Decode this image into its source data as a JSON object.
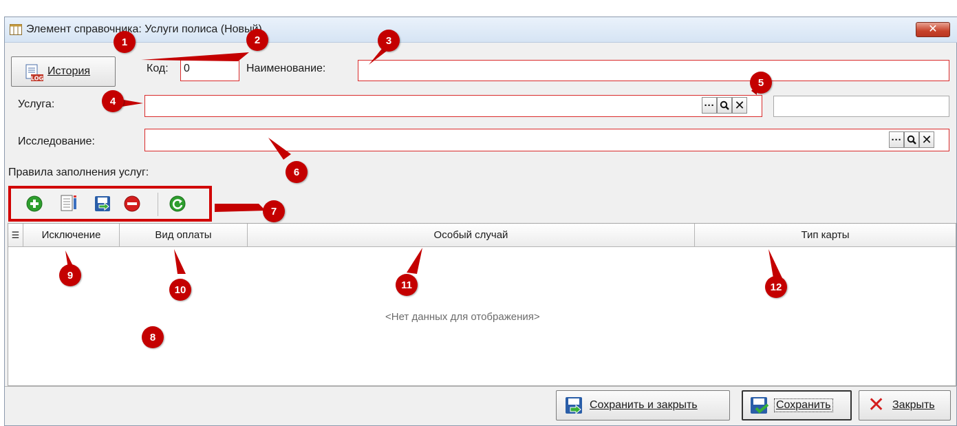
{
  "window": {
    "title": "Элемент справочника: Услуги полиса (Новый)",
    "close_symbol": "✕"
  },
  "toolbar": {
    "history_label": "История",
    "history_icon_text": "LOG"
  },
  "form": {
    "code_label": "Код:",
    "code_value": "0",
    "name_label": "Наименование:",
    "name_value": "",
    "service_label": "Услуга:",
    "service_value": "",
    "service_extra_value": "",
    "research_label": "Исследование:",
    "research_value": "",
    "rules_label": "Правила заполнения услуг:",
    "picker_buttons": [
      "···",
      "🔍",
      "✕"
    ]
  },
  "grid": {
    "columns": [
      "Исключение",
      "Вид оплаты",
      "Особый случай",
      "Тип карты"
    ],
    "empty_text": "<Нет данных для отображения>"
  },
  "footer": {
    "save_close_label": "Сохранить и закрыть",
    "save_label": "Сохранить",
    "close_label": "Закрыть"
  },
  "callouts": [
    "1",
    "2",
    "3",
    "4",
    "5",
    "6",
    "7",
    "8",
    "9",
    "10",
    "11",
    "12"
  ],
  "colors": {
    "callout": "#c40000",
    "required_border": "#d92a2a",
    "add_icon": "#2e9e2e",
    "delete_icon": "#d41d1d"
  }
}
